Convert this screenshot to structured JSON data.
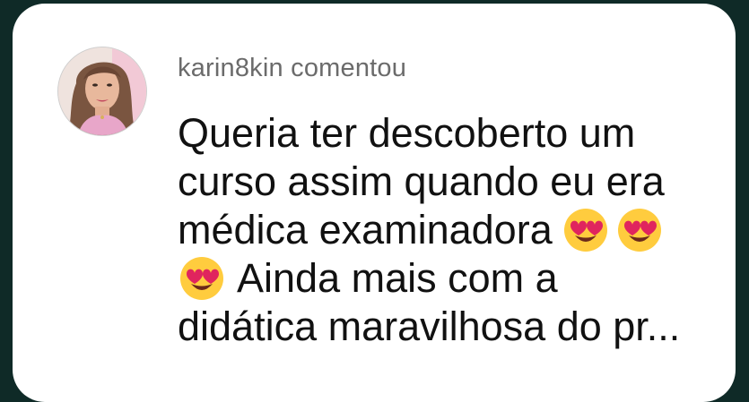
{
  "comment": {
    "username": "karin8kin",
    "action": "comentou",
    "lines": [
      "Queria ter descoberto um",
      "curso assim quando eu era",
      "médica examinadora",
      "Ainda mais com a",
      "didática maravilhosa do pr..."
    ],
    "emoji_icon": "heart-eyes-emoji-icon"
  },
  "colors": {
    "background": "#0f2a27",
    "card": "#ffffff",
    "header_text": "#6b6b6b",
    "body_text": "#111111"
  }
}
